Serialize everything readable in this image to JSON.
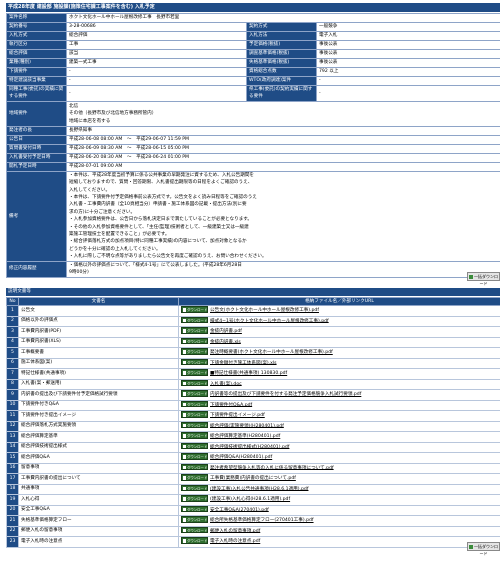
{
  "title": "平成28年度 建設部 施設課(施策住宅課工事案件を含む) 入札予定",
  "info_rows": [
    {
      "l1": "案件名称",
      "v1": "ホクト文化ホール中ホール屋根改修工事　長野市若里",
      "span": true
    },
    {
      "l1": "契約番号",
      "v1": "3-28-00686",
      "l2": "契約方式",
      "v2": "一般競争"
    },
    {
      "l1": "入札方式",
      "v1": "総合評価",
      "l2": "入札方法",
      "v2": "電子入札"
    },
    {
      "l1": "執行区分",
      "v1": "工事",
      "l2": "予定価格(税抜)",
      "v2": "事後公表"
    },
    {
      "l1": "総合評価",
      "v1": "該当",
      "l2": "調査基準価格(税抜)",
      "v2": "事後公表"
    },
    {
      "l1": "業種(種別)",
      "v1": "建築一式工事",
      "l2": "失格基準価格(税抜)",
      "v2": "事後公表"
    },
    {
      "l1": "下請要件",
      "v1": "-",
      "l2": "資格総合点数",
      "v2": "792 以上"
    },
    {
      "l1": "特定建設該当事業",
      "v1": "-",
      "l2": "WTO(政府調達)案件",
      "v2": "-"
    },
    {
      "l1": "同種工事(委託)の実績に関する要件",
      "v1": "-",
      "l2": "県工事(委託)の契約実績に関する要件",
      "v2": "-"
    }
  ],
  "region": {
    "label": "地域要件",
    "lines": [
      "北信",
      "その他（長野市及び北信地方事務所管内）",
      "地域に本店を有する"
    ]
  },
  "office": {
    "label": "発注者の長",
    "value": "長野県知事"
  },
  "schedule": [
    {
      "label": "公告日",
      "value": "平成28-06-08 08:00 AM　～　平成29-06-07 11:59 PM"
    },
    {
      "label": "質問書受付日時",
      "value": "平成28-06-09 08:30 AM　～　平成28-06-15 05:00 PM"
    },
    {
      "label": "入札書受付予定日時",
      "value": "平成28-06-20 08:30 AM　～　平成28-06-24 01:00 PM"
    },
    {
      "label": "開札予定日時",
      "value": "平成28-07-01 09:00 AM"
    }
  ],
  "remarks": {
    "label": "備考",
    "lines": [
      "・本件は、平成28年度当初予算に係る公共事業の早期発注に資するため、入札公告期間を",
      "短縮しておりますので、質問・回答期限、入札書提出期限等の日程をよくご確認のうえ、",
      "入札してください。",
      "・本件は、下請要件付予定価格事前公表方式です。公告文をよく読み日程等をご確認のうえ",
      "入札書・工事費内訳書（全10頁相当分）申請書・施工体系図の記載・提出方法(別に要",
      "求の方)に十分ご注意ください。",
      "・入札参加資格要件は、公告日から落札決定日まで満たしていることが必要となります。",
      "・その他の入札参加資格要件として、「主任(監理)技術者として、一級建築士又は一級建",
      "築施工管理技士を配置できること」が必要です。",
      "・総合評価落札方式の加点項目(特に同種工事実績)の内容について、加点対象となるか",
      "どうかを十分に確認の上入札してください。",
      "・入札に際しご不明な点等がありましたら公告文を再度ご確認のうえ、お問い合わせください。"
    ]
  },
  "revision": {
    "label": "修正内容履歴",
    "lines": [
      "・価格以外の評価点について、「様式4-1号」にて公表しました。(平成28年6月28日",
      "9時00分)"
    ]
  },
  "download_all_label": "一括ダウンロード",
  "docs_section_title": "説明文書等",
  "docs_headers": {
    "no": "No",
    "name": "文書名",
    "file": "格納ファイル名／外部リンクURL"
  },
  "download_button_label": "ダウンロード",
  "docs": [
    {
      "no": "1",
      "name": "公告文",
      "file": "公告文(ホクト文化ホール中ホール屋根改修工事).pdf"
    },
    {
      "no": "2",
      "name": "価格以外の評価点",
      "file": "様式4−1号(ホクト文化ホール中ホール屋根改修工事).pdf"
    },
    {
      "no": "3",
      "name": "工事費内訳書(PDF)",
      "file": "金抜内訳書.pdf"
    },
    {
      "no": "4",
      "name": "工事費内訳書(XLS)",
      "file": "金抜内訳書.xls"
    },
    {
      "no": "5",
      "name": "工事概要書",
      "file": "発注時概要書(ホクト文化ホール中ホール屋根改修工事).pdf"
    },
    {
      "no": "6",
      "name": "施工体系図(案)",
      "file": "下請金額付き施工体系図(案).xls"
    },
    {
      "no": "7",
      "name": "特記仕様書(共通事項)",
      "file": "■特記仕様書(共通事項) 130830.pdf"
    },
    {
      "no": "8",
      "name": "入札書(案・郵送用)",
      "file": "入札書(案).doc"
    },
    {
      "no": "9",
      "name": "内訳書の提出及び下請要件付予定価格試行要領",
      "file": "内訳書等の提出及び下請要件を付する発注予定価格競争入札試行要領.pdf"
    },
    {
      "no": "10",
      "name": "下請要件付きQ&A",
      "file": "下請要件付Q&A.pdf"
    },
    {
      "no": "11",
      "name": "下請要件付き提出イメージ",
      "file": "下請要件提出イメージ.pdf"
    },
    {
      "no": "12",
      "name": "総合評価落札方式実施要領",
      "file": "総合評価(実施要領)(H280401).pdf"
    },
    {
      "no": "13",
      "name": "総合評価算定基準",
      "file": "総合評価算定基準(H280401).pdf"
    },
    {
      "no": "14",
      "name": "総合評価技術提出様式",
      "file": "総合評価技術提出様式(H280401).pdf"
    },
    {
      "no": "15",
      "name": "総合評価Q&A",
      "file": "総合評価Q&A(H280401).pdf"
    },
    {
      "no": "16",
      "name": "留意事項",
      "file": "発注者希望型競争入札等の入札に係る留意事項について.pdf"
    },
    {
      "no": "17",
      "name": "工事費内訳書の提出について",
      "file": "工事費(業務費)内訳書の提出について.pdf"
    },
    {
      "no": "18",
      "name": "共通事項",
      "file": "(建設工事)入札公告共通事項(H28.6.1適用).pdf"
    },
    {
      "no": "19",
      "name": "入札心得",
      "file": "(建設工事)入札心得(H28.6.1適用).pdf"
    },
    {
      "no": "20",
      "name": "安全工事Q&A",
      "file": "安全工事Q&A(270401).pdf"
    },
    {
      "no": "21",
      "name": "失格基準価格算定フロー",
      "file": "総合所失格基準価格算定フロー(270401工事).pdf"
    },
    {
      "no": "22",
      "name": "郵便入札の留意事項",
      "file": "郵便入札の留意事項.pdf"
    },
    {
      "no": "23",
      "name": "電子入札時の注意点",
      "file": "電子入札時の注意点.pdf"
    }
  ],
  "colors": {
    "header_blue": "#1f4c86",
    "download_green": "#2f6e2f"
  }
}
